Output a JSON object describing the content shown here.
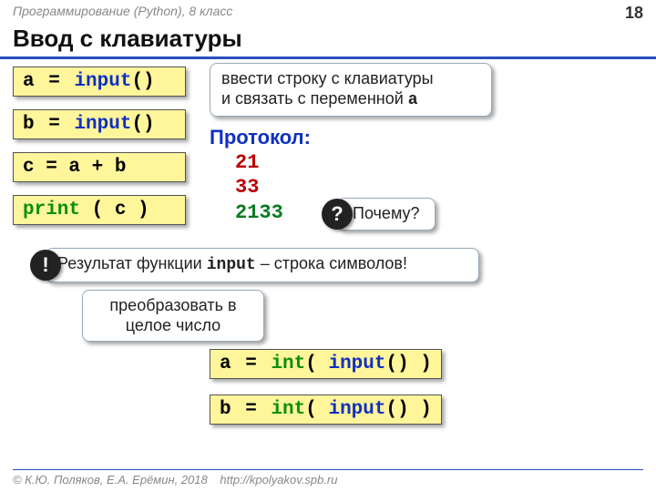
{
  "header": {
    "breadcrumb": "Программирование (Python), 8 класс",
    "page": "18",
    "title": "Ввод с клавиатуры"
  },
  "code": {
    "a_input": {
      "lhs": "a",
      "eq": "=",
      "fn": "input",
      "tail": "()"
    },
    "b_input": {
      "lhs": "b",
      "eq": "=",
      "fn": "input",
      "tail": "()"
    },
    "c_sum": {
      "text": "c = a + b"
    },
    "print_c": {
      "fn": "print",
      "arg": " ( c )"
    },
    "a_int": {
      "lhs": "a",
      "eq": "=",
      "fn1": "int",
      "mid": "( ",
      "fn2": "input",
      "tail": "() )"
    },
    "b_int": {
      "lhs": "b",
      "eq": "=",
      "fn1": "int",
      "mid": "( ",
      "fn2": "input",
      "tail": "() )"
    }
  },
  "callouts": {
    "intro_l1": "ввести строку с клавиатуры",
    "intro_l2_pre": "и связать с переменной ",
    "intro_l2_mono": "a",
    "why": "Почему?",
    "result_pre": "Результат функции ",
    "result_mono": "input",
    "result_post": " – строка символов!",
    "convert_l1": "преобразовать в",
    "convert_l2": "целое число"
  },
  "protocol": {
    "label": "Протокол:",
    "v1": "21",
    "v2": "33",
    "v3": "2133"
  },
  "footer": {
    "copy": "© К.Ю. Поляков, Е.А. Ерёмин, 2018",
    "url": "http://kpolyakov.spb.ru"
  }
}
